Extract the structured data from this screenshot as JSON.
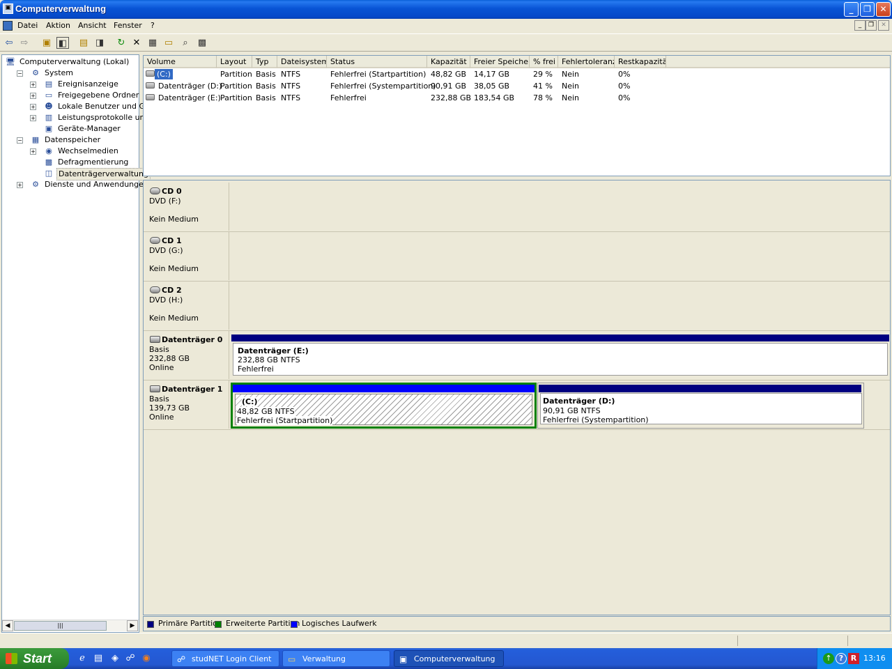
{
  "window": {
    "title": "Computerverwaltung"
  },
  "menu": [
    "Datei",
    "Aktion",
    "Ansicht",
    "Fenster",
    "?"
  ],
  "tree": [
    {
      "label": "Computerverwaltung (Lokal)",
      "level": 0,
      "expander": "",
      "icon": "computer-icon"
    },
    {
      "label": "System",
      "level": 1,
      "expander": "−",
      "icon": "tools-icon"
    },
    {
      "label": "Ereignisanzeige",
      "level": 2,
      "expander": "+",
      "icon": "event-viewer-icon"
    },
    {
      "label": "Freigegebene Ordner",
      "level": 2,
      "expander": "+",
      "icon": "shared-folder-icon"
    },
    {
      "label": "Lokale Benutzer und Gruppe",
      "level": 2,
      "expander": "+",
      "icon": "users-icon"
    },
    {
      "label": "Leistungsprotokolle und War",
      "level": 2,
      "expander": "+",
      "icon": "performance-icon"
    },
    {
      "label": "Geräte-Manager",
      "level": 2,
      "expander": "",
      "icon": "device-manager-icon"
    },
    {
      "label": "Datenspeicher",
      "level": 1,
      "expander": "−",
      "icon": "storage-icon"
    },
    {
      "label": "Wechselmedien",
      "level": 2,
      "expander": "+",
      "icon": "removable-media-icon"
    },
    {
      "label": "Defragmentierung",
      "level": 2,
      "expander": "",
      "icon": "defrag-icon"
    },
    {
      "label": "Datenträgerverwaltung",
      "level": 2,
      "expander": "",
      "icon": "disk-management-icon",
      "selected": true
    },
    {
      "label": "Dienste und Anwendungen",
      "level": 1,
      "expander": "+",
      "icon": "services-icon"
    }
  ],
  "list": {
    "columns": [
      "Volume",
      "Layout",
      "Typ",
      "Dateisystem",
      "Status",
      "Kapazität",
      "Freier Speicher",
      "% frei",
      "Fehlertoleranz",
      "Restkapazität"
    ],
    "rows": [
      [
        "(C:)",
        "Partition",
        "Basis",
        "NTFS",
        "Fehlerfrei (Startpartition)",
        "48,82 GB",
        "14,17 GB",
        "29 %",
        "Nein",
        "0%"
      ],
      [
        "Datenträger (D:)",
        "Partition",
        "Basis",
        "NTFS",
        "Fehlerfrei (Systempartition)",
        "90,91 GB",
        "38,05 GB",
        "41 %",
        "Nein",
        "0%"
      ],
      [
        "Datenträger (E:)",
        "Partition",
        "Basis",
        "NTFS",
        "Fehlerfrei",
        "232,88 GB",
        "183,54 GB",
        "78 %",
        "Nein",
        "0%"
      ]
    ]
  },
  "disks": [
    {
      "name": "CD 0",
      "lines": [
        "DVD (F:)",
        "",
        "Kein Medium"
      ],
      "volumes": []
    },
    {
      "name": "CD 1",
      "lines": [
        "DVD (G:)",
        "",
        "Kein Medium"
      ],
      "volumes": []
    },
    {
      "name": "CD 2",
      "lines": [
        "DVD (H:)",
        "",
        "Kein Medium"
      ],
      "volumes": []
    },
    {
      "name": "Datenträger 0",
      "lines": [
        "Basis",
        "232,88 GB",
        "Online"
      ],
      "volumes": [
        {
          "title": "Datenträger  (E:)",
          "size": "232,88 GB NTFS",
          "status": "Fehlerfrei"
        }
      ]
    },
    {
      "name": "Datenträger 1",
      "lines": [
        "Basis",
        "139,73 GB",
        "Online"
      ],
      "volumes": [
        {
          "title": "(C:)",
          "size": "48,82 GB NTFS",
          "status": "Fehlerfrei (Startpartition)"
        },
        {
          "title": "Datenträger  (D:)",
          "size": "90,91 GB NTFS",
          "status": "Fehlerfrei (Systempartition)"
        }
      ]
    }
  ],
  "legend": [
    {
      "label": "Primäre Partition",
      "color": "#000080"
    },
    {
      "label": "Erweiterte Partition",
      "color": "#008000"
    },
    {
      "label": "Logisches Laufwerk",
      "color": "#0000ff"
    }
  ],
  "taskbar": {
    "start": "Start",
    "tasks": [
      "studNET Login Client",
      "Verwaltung",
      "Computerverwaltung"
    ],
    "clock": "13:16"
  }
}
